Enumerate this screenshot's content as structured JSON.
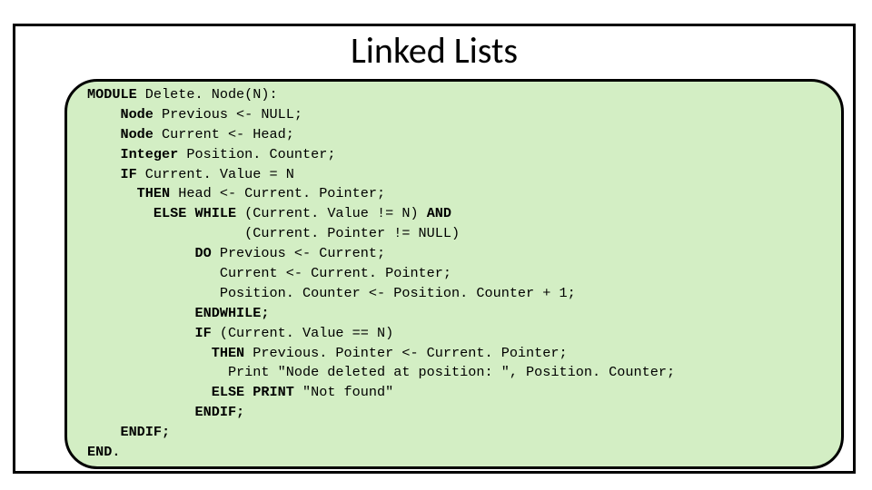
{
  "title": "Linked Lists",
  "code": {
    "l1a": "MODULE",
    "l1b": " Delete. Node(N):",
    "l2a": "    Node",
    "l2b": " Previous <- NULL;",
    "l3a": "    Node",
    "l3b": " Current <- Head;",
    "l4a": "    Integer",
    "l4b": " Position. Counter;",
    "l5a": "    IF",
    "l5b": " Current. Value = N",
    "l6a": "      THEN",
    "l6b": " Head <- Current. Pointer;",
    "l7a": "        ELSE WHILE",
    "l7b": " (Current. Value != N) ",
    "l7c": "AND",
    "l8": "                   (Current. Pointer != NULL)",
    "l9a": "             DO",
    "l9b": " Previous <- Current;",
    "l10": "                Current <- Current. Pointer;",
    "l11": "                Position. Counter <- Position. Counter + 1;",
    "l12": "             ENDWHILE;",
    "l13a": "             IF",
    "l13b": " (Current. Value == N)",
    "l14a": "               THEN",
    "l14b": " Previous. Pointer <- Current. Pointer;",
    "l15": "                 Print \"Node deleted at position: \", Position. Counter;",
    "l16a": "               ELSE PRINT",
    "l16b": " \"Not found\"",
    "l17": "             ENDIF;",
    "l18": "    ENDIF;",
    "l19": "END."
  }
}
